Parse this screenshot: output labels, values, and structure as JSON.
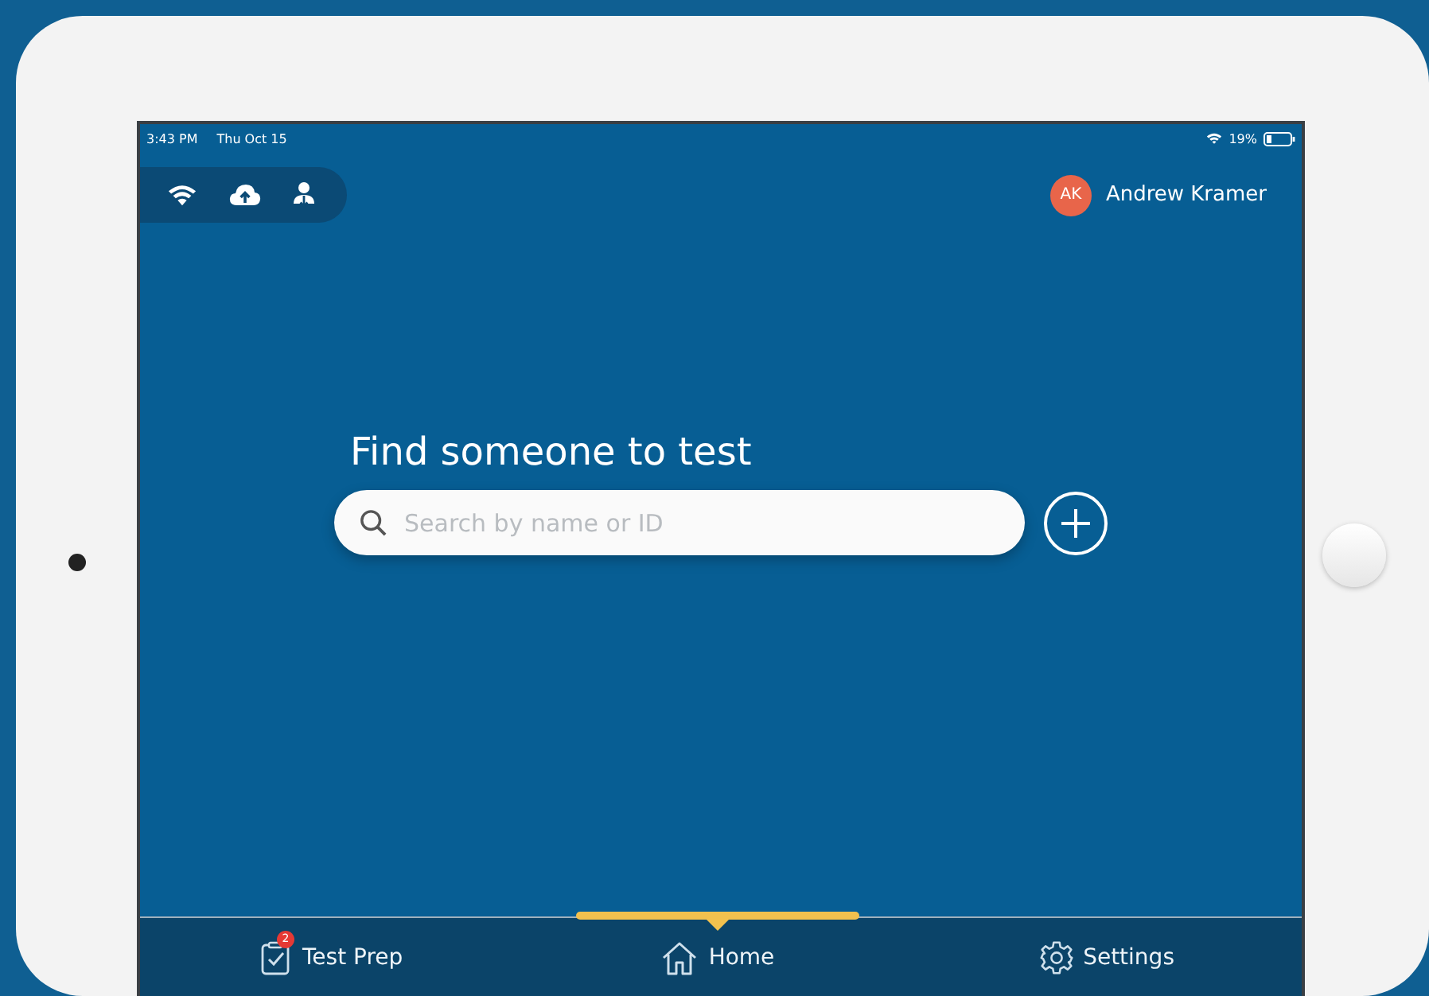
{
  "status_bar": {
    "time": "3:43 PM",
    "date": "Thu Oct 15",
    "battery": "19%"
  },
  "toolbar": {
    "user": {
      "initials": "AK",
      "name": "Andrew Kramer"
    }
  },
  "main": {
    "heading": "Find someone to test",
    "search": {
      "placeholder": "Search by name or ID"
    }
  },
  "tab_bar": {
    "tabs": [
      {
        "kind": "test-prep",
        "label": "Test Prep",
        "badge": "2",
        "selected": false
      },
      {
        "kind": "home",
        "label": "Home",
        "selected": true
      },
      {
        "kind": "settings",
        "label": "Settings",
        "selected": false
      }
    ]
  }
}
